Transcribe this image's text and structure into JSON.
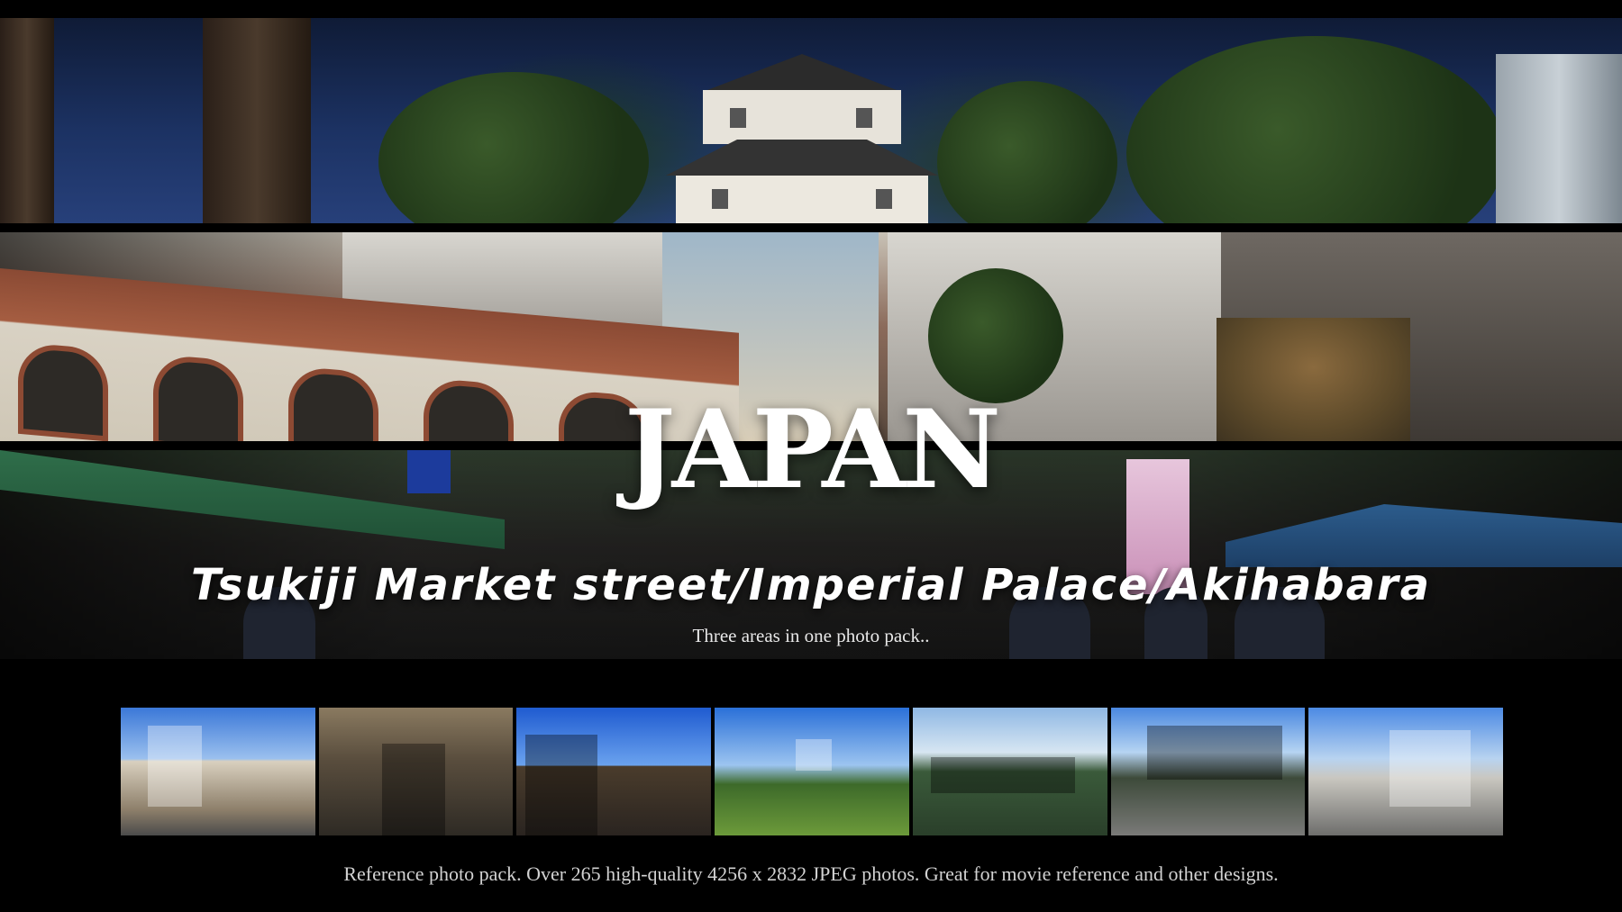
{
  "hero": {
    "title": "JAPAN",
    "subtitle": "Tsukiji Market street/Imperial Palace/Akihabara",
    "tagline": "Three areas in one photo pack.."
  },
  "bands": [
    {
      "scene": "imperial-palace-tower"
    },
    {
      "scene": "akihabara-brick-viaduct"
    },
    {
      "scene": "tsukiji-market-street"
    }
  ],
  "thumbnails": [
    {
      "scene": "street-intersection"
    },
    {
      "scene": "market-alley"
    },
    {
      "scene": "palace-gate"
    },
    {
      "scene": "palace-moat-tree"
    },
    {
      "scene": "stone-wall-moat"
    },
    {
      "scene": "railway-bridge-street"
    },
    {
      "scene": "city-avenue"
    }
  ],
  "footer": {
    "text": "Reference photo pack. Over 265 high-quality 4256 x 2832 JPEG photos. Great for movie reference and other designs."
  },
  "colors": {
    "background": "#000000",
    "text": "#ffffff",
    "footer_text": "#d2d2d2"
  }
}
